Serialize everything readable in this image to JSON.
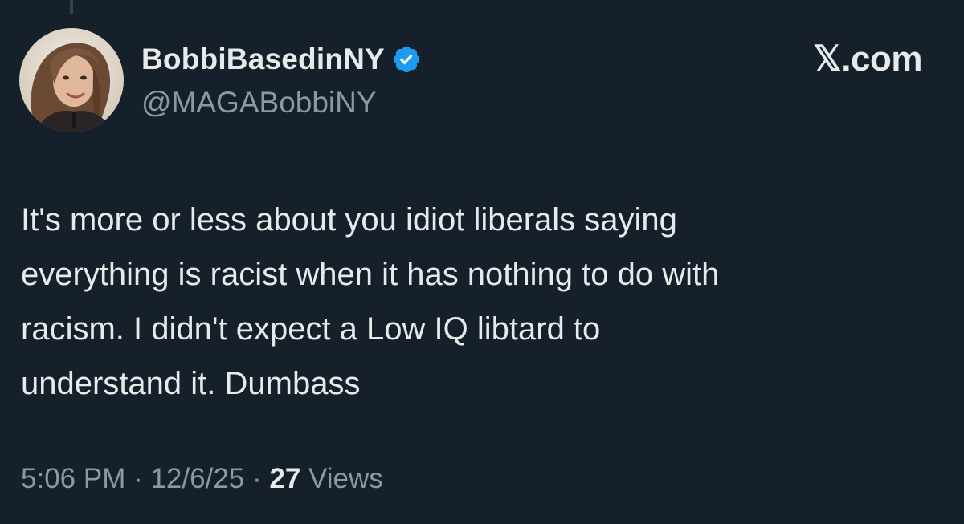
{
  "author": {
    "display_name": "BobbiBasedinNY",
    "handle": "@MAGABobbiNY",
    "verified": true,
    "avatar_icon": "profile-photo-woman"
  },
  "brand": {
    "label": "𝕏.com"
  },
  "tweet": {
    "lines": [
      "It's more or less about you idiot liberals saying",
      "everything is racist when it has nothing to do with",
      "racism. I didn't expect a Low IQ libtard to",
      "understand it. Dumbass"
    ]
  },
  "meta": {
    "time": "5:06 PM",
    "separator": " · ",
    "date": "12/6/25",
    "views_count": "27",
    "views_label": " Views"
  },
  "colors": {
    "background": "#15202b",
    "text_primary": "#e7e9ea",
    "text_secondary": "#8b98a5",
    "verified_badge": "#1d9bf0"
  }
}
